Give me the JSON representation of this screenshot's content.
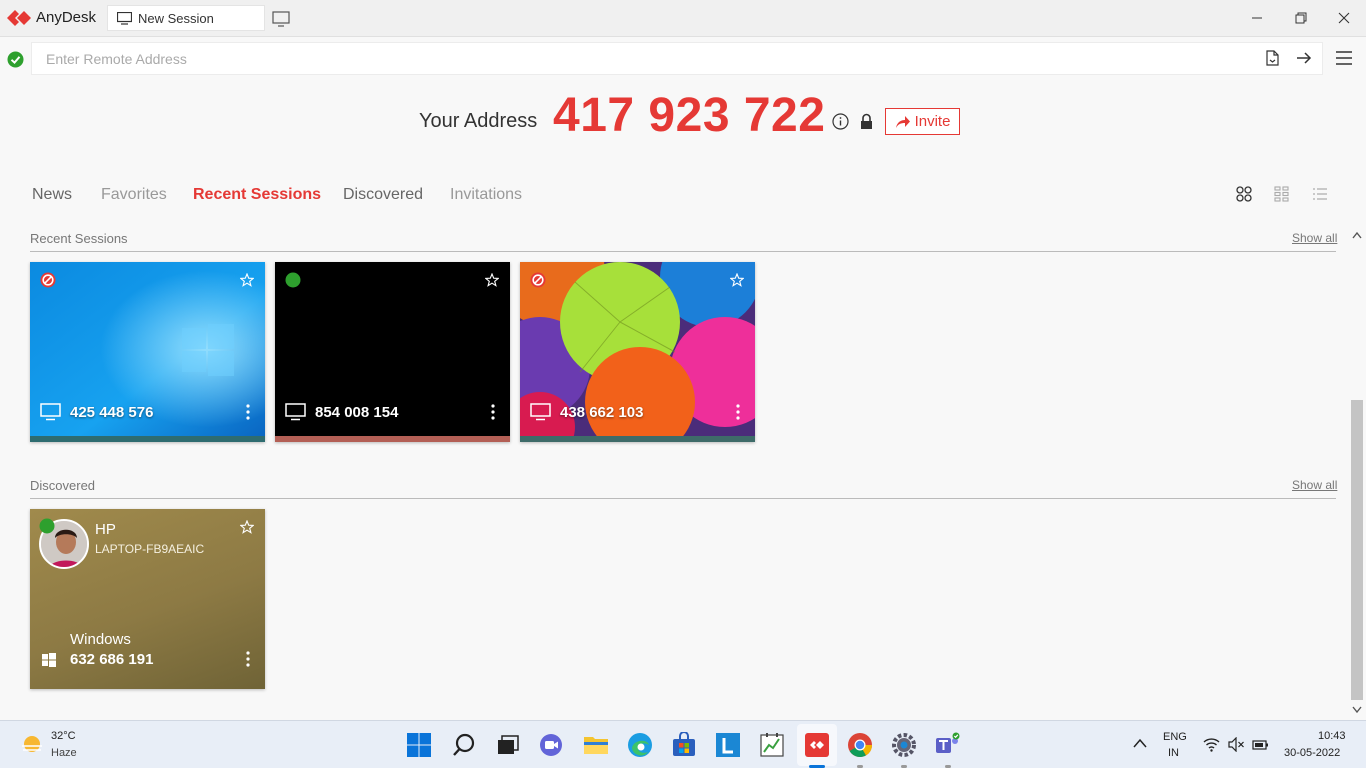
{
  "titlebar": {
    "app_name": "AnyDesk",
    "tab_label": "New Session"
  },
  "address_bar": {
    "placeholder": "Enter Remote Address"
  },
  "your_address": {
    "label": "Your Address",
    "number": "417 923 722",
    "invite_label": "Invite"
  },
  "nav_tabs": {
    "news": "News",
    "favorites": "Favorites",
    "recent_sessions": "Recent Sessions",
    "discovered": "Discovered",
    "invitations": "Invitations",
    "active": "recent_sessions"
  },
  "recent_sessions": {
    "header": "Recent Sessions",
    "show_all": "Show all",
    "cards": [
      {
        "id": "425 448 576",
        "status": "blocked",
        "bar_color": "#2e6c70"
      },
      {
        "id": "854 008 154",
        "status": "online",
        "bar_color": "#b35f55"
      },
      {
        "id": "438 662 103",
        "status": "blocked",
        "bar_color": "#3e6b69"
      }
    ]
  },
  "discovered": {
    "header": "Discovered",
    "show_all": "Show all",
    "cards": [
      {
        "name": "HP",
        "hostname": "LAPTOP-FB9AEAIC",
        "os": "Windows",
        "id": "632 686 191",
        "status": "online"
      }
    ]
  },
  "taskbar": {
    "weather_temp": "32°C",
    "weather_desc": "Haze",
    "lang_line1": "ENG",
    "lang_line2": "IN",
    "time": "10:43",
    "date": "30-05-2022",
    "apps": [
      "start-icon",
      "search-icon",
      "task-view-icon",
      "chat-icon",
      "file-explorer-icon",
      "edge-icon",
      "store-icon",
      "l-app-icon",
      "notes-app-icon",
      "anydesk-icon",
      "chrome-icon",
      "settings-icon",
      "teams-icon"
    ]
  },
  "colors": {
    "accent_red": "#e53935",
    "online_green": "#2ea02e"
  }
}
